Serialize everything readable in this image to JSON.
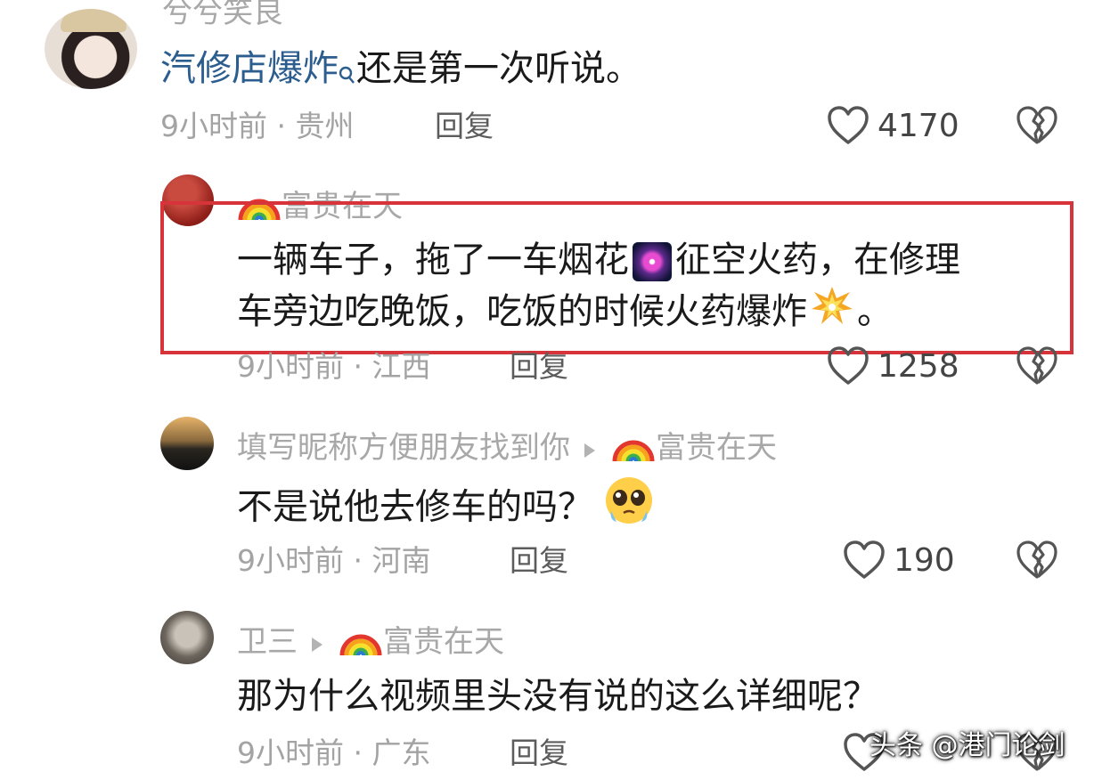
{
  "comments": [
    {
      "name": "兮兮笑良",
      "text_link": "汽修店爆炸",
      "text_rest": "还是第一次听说。",
      "meta": "9小时前 · 贵州",
      "reply": "回复",
      "likes": "4170"
    },
    {
      "name": "富贵在天",
      "line1_a": "一辆车子，拖了一车烟花",
      "line1_b": "征空火药，在修理",
      "line2_a": "车旁边吃晚饭，吃饭的时候火药爆炸",
      "line2_b": "。",
      "meta": "9小时前 · 江西",
      "reply": "回复",
      "likes": "1258"
    },
    {
      "name": "填写昵称方便朋友找到你",
      "reply_to": "富贵在天",
      "text": "不是说他去修车的吗？",
      "meta": "9小时前 · 河南",
      "reply": "回复",
      "likes": "190"
    },
    {
      "name": "卫三",
      "reply_to": "富贵在天",
      "text": "那为什么视频里头没有说的这么详细呢？",
      "meta": "9小时前 · 广东",
      "reply": "回复"
    }
  ],
  "watermark": "头条 @港门论剑",
  "icons": {
    "search": "search-icon",
    "like": "heart-icon",
    "dislike": "broken-heart-icon",
    "arrow": "reply-arrow-icon",
    "rainbow": "rainbow-emoji",
    "fireworks": "fireworks-emoji",
    "explosion": "explosion-emoji",
    "pleading": "pleading-face-emoji"
  },
  "colors": {
    "highlight": "#d6343a",
    "link": "#2c5d8f"
  }
}
